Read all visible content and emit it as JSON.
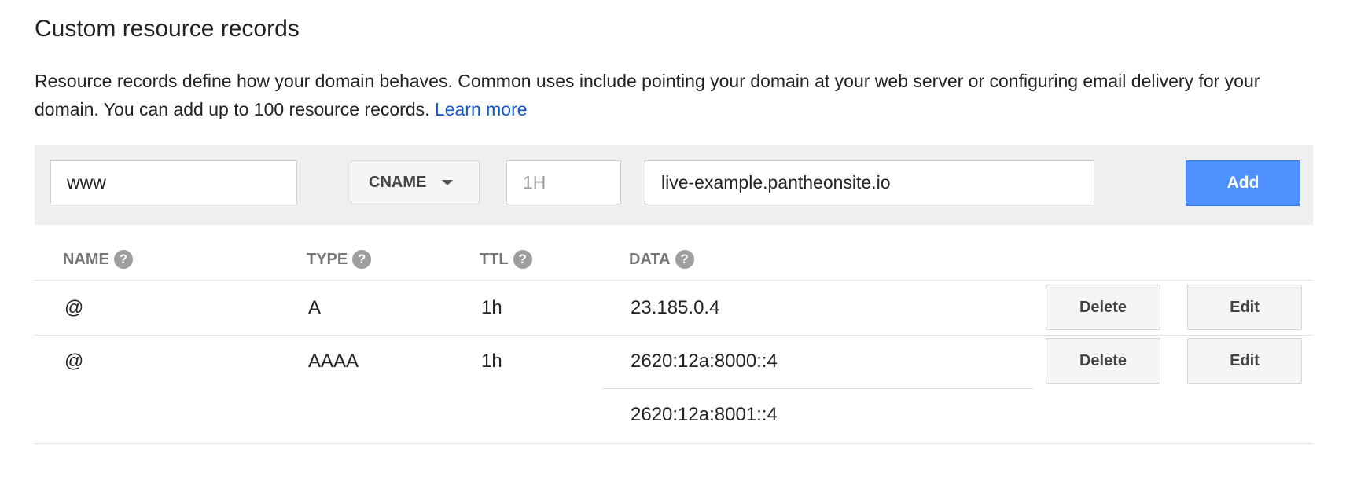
{
  "section": {
    "title": "Custom resource records",
    "description": "Resource records define how your domain behaves. Common uses include pointing your domain at your web server or configuring email delivery for your domain. You can add up to 100 resource records.",
    "learn_more": "Learn more"
  },
  "form": {
    "name_value": "www",
    "type_value": "CNAME",
    "ttl_placeholder": "1H",
    "data_value": "live-example.pantheonsite.io",
    "add_label": "Add"
  },
  "table": {
    "headers": {
      "name": "NAME",
      "type": "TYPE",
      "ttl": "TTL",
      "data": "DATA"
    },
    "help_glyph": "?",
    "rows": [
      {
        "name": "@",
        "type": "A",
        "ttl": "1h",
        "data": [
          "23.185.0.4"
        ],
        "delete_label": "Delete",
        "edit_label": "Edit"
      },
      {
        "name": "@",
        "type": "AAAA",
        "ttl": "1h",
        "data": [
          "2620:12a:8000::4",
          "2620:12a:8001::4"
        ],
        "delete_label": "Delete",
        "edit_label": "Edit"
      }
    ]
  },
  "colors": {
    "accent": "#4d90fe",
    "link": "#1155cc",
    "form_background": "#efefef"
  },
  "icons": {
    "help": "question-circle-icon",
    "dropdown": "caret-down-icon"
  }
}
